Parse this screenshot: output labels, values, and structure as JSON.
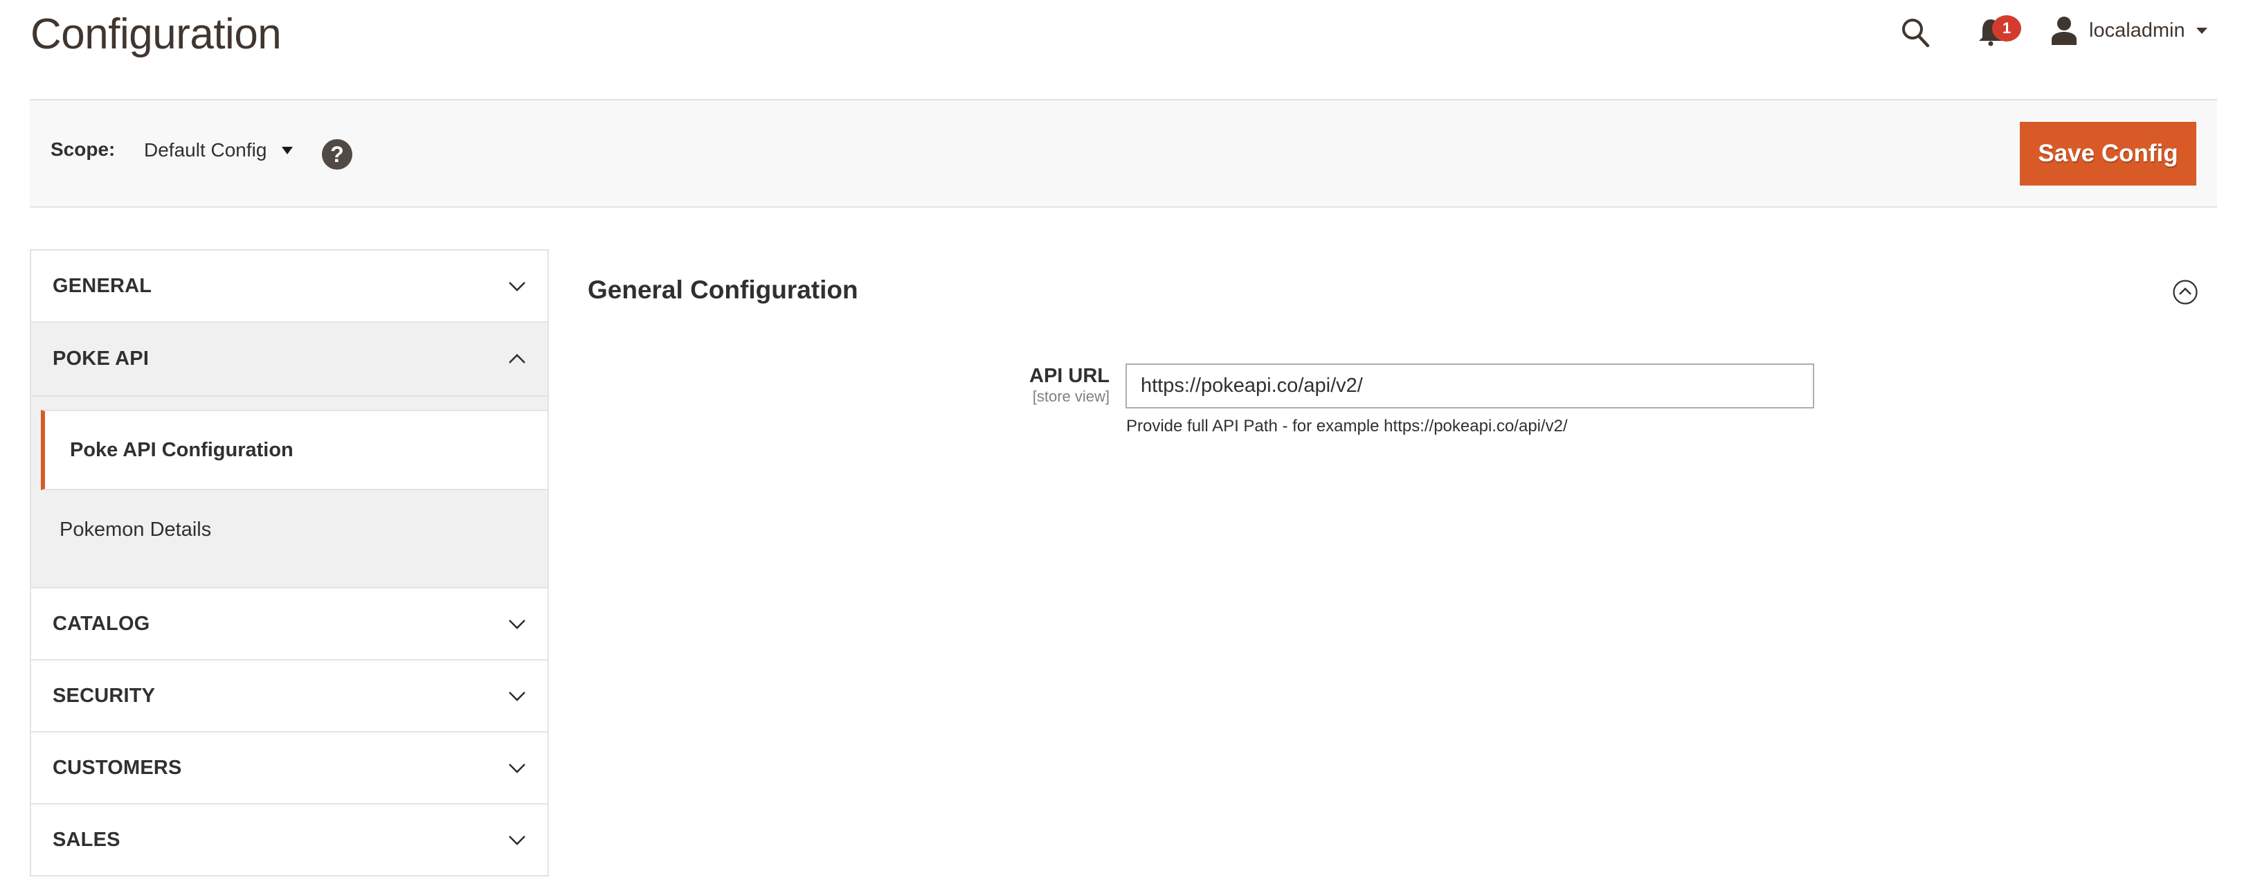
{
  "header": {
    "title": "Configuration",
    "notifications_count": "1",
    "user_name": "localadmin",
    "icons": {
      "search": "search-icon",
      "notifications": "bell-icon",
      "user": "user-icon",
      "user_menu": "caret-down-icon"
    }
  },
  "toolbar": {
    "scope_label": "Scope:",
    "scope_value": "Default Config",
    "help_glyph": "?",
    "save_label": "Save Config"
  },
  "colors": {
    "accent": "#d85b27",
    "badge": "#d33b2f",
    "text": "#303030",
    "title": "#41362f"
  },
  "sidebar": {
    "tabs": [
      {
        "label": "GENERAL",
        "expanded": false
      },
      {
        "label": "POKE API",
        "expanded": true,
        "items": [
          {
            "label": "Poke API Configuration",
            "active": true
          },
          {
            "label": "Pokemon Details",
            "active": false
          }
        ]
      },
      {
        "label": "CATALOG",
        "expanded": false
      },
      {
        "label": "SECURITY",
        "expanded": false
      },
      {
        "label": "CUSTOMERS",
        "expanded": false
      },
      {
        "label": "SALES",
        "expanded": false
      }
    ]
  },
  "main": {
    "section_title": "General Configuration",
    "section_expanded": true,
    "fields": [
      {
        "label": "API URL",
        "scope": "[store view]",
        "value": "https://pokeapi.co/api/v2/",
        "note": "Provide full API Path - for example https://pokeapi.co/api/v2/"
      }
    ]
  }
}
